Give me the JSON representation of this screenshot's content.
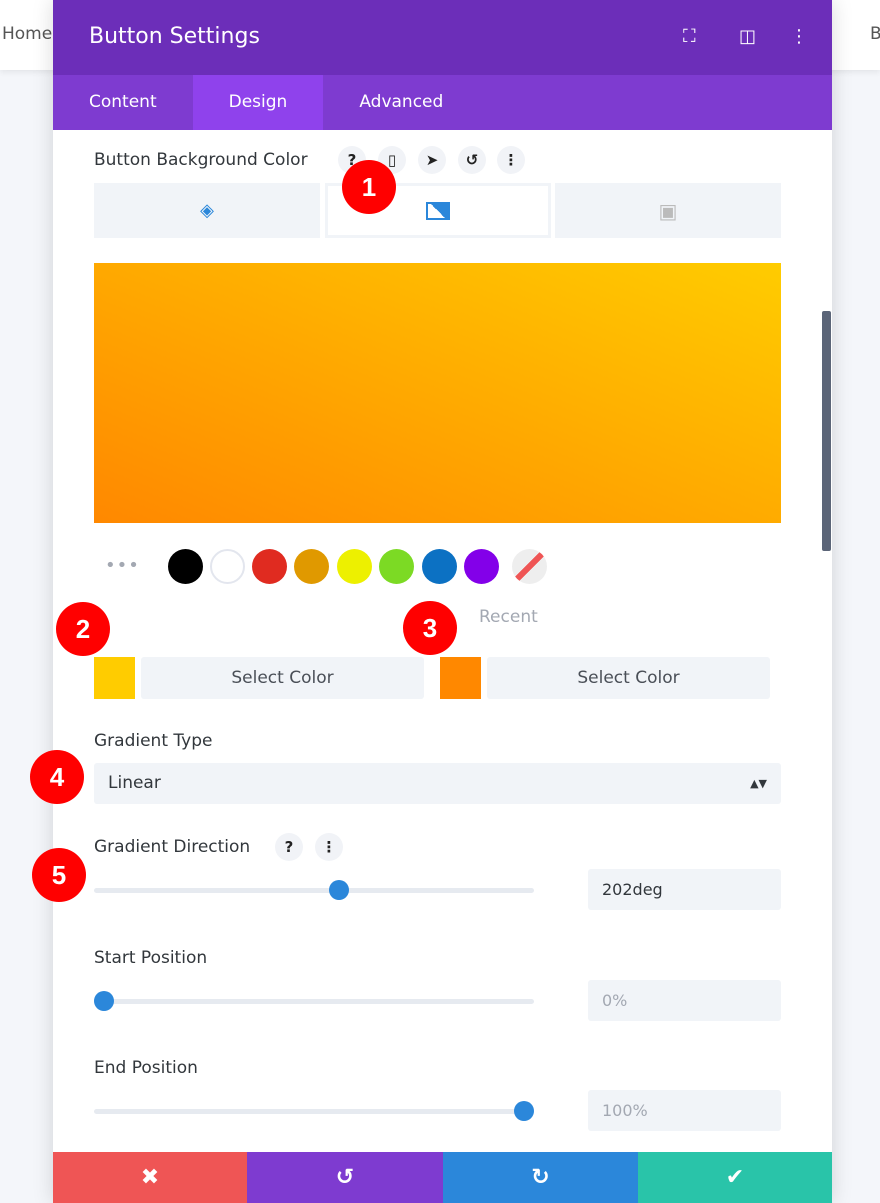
{
  "background": {
    "nav_left": "Home",
    "nav_right": "B"
  },
  "header": {
    "title": "Button Settings",
    "icons": [
      "fullscreen-icon",
      "split-view-icon",
      "more-icon"
    ]
  },
  "tabs": [
    {
      "label": "Content"
    },
    {
      "label": "Design",
      "active": true
    },
    {
      "label": "Advanced"
    }
  ],
  "bg_color": {
    "label": "Button Background Color",
    "icons": [
      "help-icon",
      "mobile-icon",
      "cursor-icon",
      "reset-icon",
      "more-icon"
    ],
    "tabs": [
      "color-fill-icon",
      "gradient-icon",
      "image-icon"
    ],
    "active_tab": "gradient"
  },
  "gradient": {
    "start_color": "#ffcc00",
    "end_color": "#ff8800"
  },
  "swatches": [
    "#000000",
    "#ffffff",
    "#e02b20",
    "#e09900",
    "#edf000",
    "#7cda24",
    "#0c71c3",
    "#8300e9",
    "transparent"
  ],
  "recent_label": "Recent",
  "color_stops": [
    {
      "color": "#ffcc00",
      "button": "Select Color"
    },
    {
      "color": "#ff8800",
      "button": "Select Color"
    }
  ],
  "gradient_type": {
    "label": "Gradient Type",
    "value": "Linear"
  },
  "gradient_direction": {
    "label": "Gradient Direction",
    "value": "202deg",
    "fraction": 0.56
  },
  "start_position": {
    "label": "Start Position",
    "value": "0%",
    "fraction": 0.0
  },
  "end_position": {
    "label": "End Position",
    "value": "100%",
    "fraction": 1.0
  },
  "badges": [
    "1",
    "2",
    "3",
    "4",
    "5"
  ],
  "footer": {
    "cancel": "✖",
    "undo": "↺",
    "redo": "↻",
    "save": "✔"
  },
  "colors": {
    "header": "#6c2eb9",
    "tabs": "#7e3bd0",
    "active_tab": "#8f42ec",
    "cancel": "#ef5555",
    "undo": "#7e3bd0",
    "redo": "#2b87da",
    "save": "#29c4a9"
  }
}
